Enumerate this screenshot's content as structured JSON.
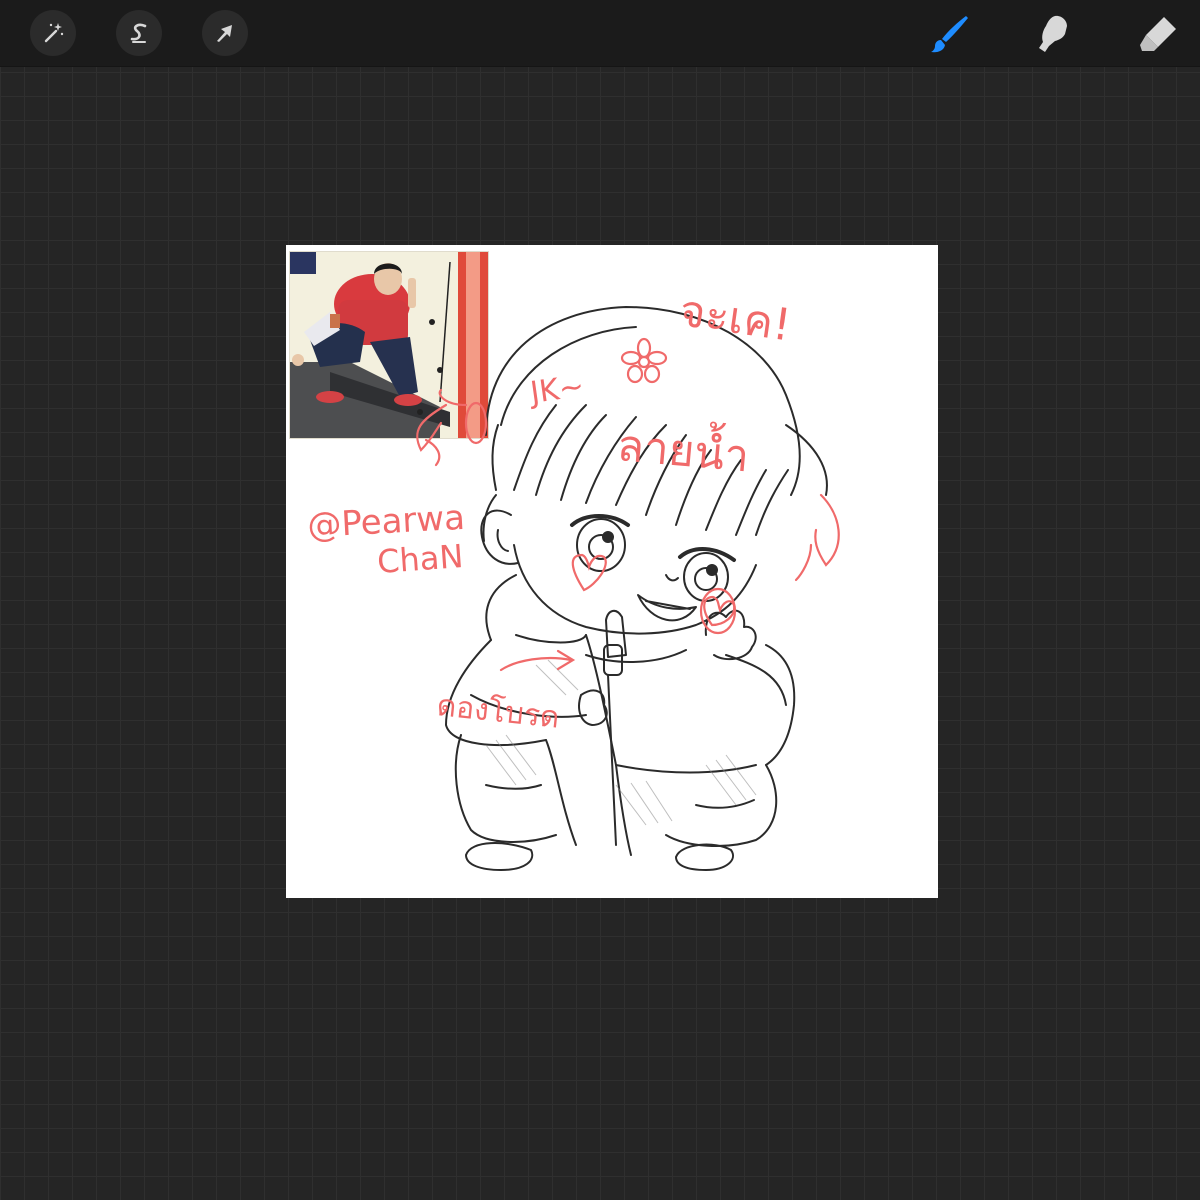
{
  "toolbar": {
    "left_tools": [
      {
        "name": "adjustments",
        "icon": "magic-wand-icon"
      },
      {
        "name": "selection",
        "icon": "selection-s-icon"
      },
      {
        "name": "transform",
        "icon": "arrow-cursor-icon"
      }
    ],
    "right_tools": [
      {
        "name": "brush",
        "icon": "brush-icon",
        "active": true,
        "color": "#1e8cff"
      },
      {
        "name": "smudge",
        "icon": "smudge-finger-icon",
        "active": false
      },
      {
        "name": "eraser",
        "icon": "eraser-icon",
        "active": false
      }
    ]
  },
  "canvas": {
    "annotations": {
      "jake_thai": "จะเค!",
      "jk": "JK~",
      "line_art_thai": "ลายน้ำ",
      "credit_line1": "@Pearwa",
      "credit_line2": "ChaN",
      "corn_dog_thai": "ดองโบรด"
    }
  },
  "colors": {
    "background": "#252525",
    "toolbar": "#1b1b1b",
    "annotation": "#f06a6a",
    "active_tool": "#1e8cff"
  }
}
